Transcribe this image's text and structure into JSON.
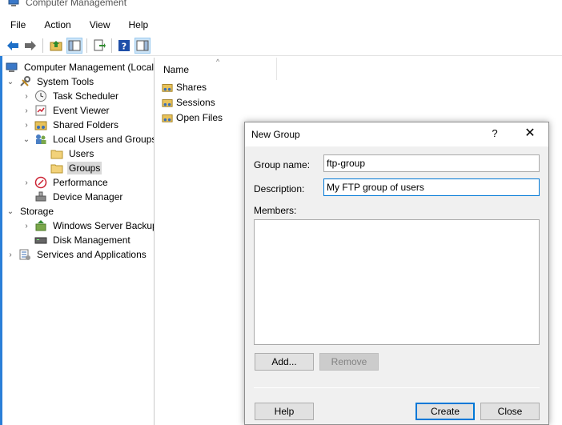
{
  "window": {
    "title": "Computer Management"
  },
  "menu": [
    "File",
    "Action",
    "View",
    "Help"
  ],
  "toolbar": {
    "buttons": [
      "back-arrow-icon",
      "forward-arrow-icon",
      "up-folder-icon",
      "show-hide-tree-icon",
      "export-list-icon",
      "help-icon",
      "properties-pane-icon"
    ]
  },
  "tree": {
    "root": "Computer Management (Local",
    "system_tools": "System Tools",
    "task_scheduler": "Task Scheduler",
    "event_viewer": "Event Viewer",
    "shared_folders": "Shared Folders",
    "local_users_groups": "Local Users and Groups",
    "users": "Users",
    "groups": "Groups",
    "performance": "Performance",
    "device_manager": "Device Manager",
    "storage": "Storage",
    "windows_server_backup": "Windows Server Backup",
    "disk_management": "Disk Management",
    "services_apps": "Services and Applications",
    "selected": "Groups"
  },
  "list": {
    "column": "Name",
    "items": [
      "Shares",
      "Sessions",
      "Open Files"
    ]
  },
  "dialog": {
    "title": "New Group",
    "help_glyph": "?",
    "close_glyph": "✕",
    "group_name_label": "Group name:",
    "group_name_value": "ftp-group",
    "description_label": "Description:",
    "description_value": "My FTP group of users",
    "members_label": "Members:",
    "add_button": "Add...",
    "remove_button": "Remove",
    "help_button": "Help",
    "create_button": "Create",
    "close_button": "Close"
  }
}
